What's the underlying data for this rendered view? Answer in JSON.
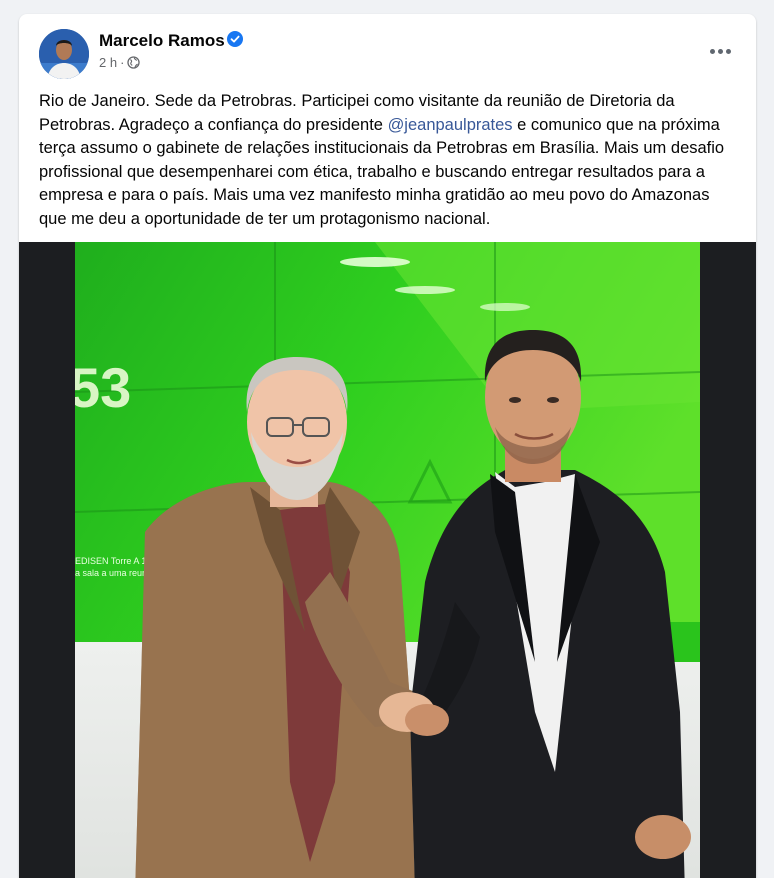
{
  "post": {
    "author": "Marcelo Ramos",
    "time": "2 h",
    "text_before": "Rio de Janeiro. Sede da Petrobras. Participei como visitante da reunião de Diretoria da Petrobras. Agradeço a confiança do presidente ",
    "mention": "@jeanpaulprates",
    "text_after": " e comunico que na próxima terça assumo o gabinete de relações institucionais da Petrobras em Brasília. Mais um desafio profissional que desempenharei com ética, trabalho e buscando entregar resultados para a empresa e para o país. Mais uma vez manifesto minha gratidão ao meu povo do Amazonas que me deu a oportunidade de ter um protagonismo nacional.",
    "photo": {
      "screen_number": "53",
      "screen_line1": "EDISEN Torre A 18 A",
      "screen_line2": "a sala a uma reunião"
    }
  },
  "icons": {
    "verified": "verified-badge-icon",
    "audience": "globe-icon",
    "more": "more-options-icon"
  },
  "colors": {
    "brand_blue": "#1877f2",
    "mention": "#385898",
    "secondary_text": "#65676b",
    "petrobras_green": "#22c21a"
  }
}
